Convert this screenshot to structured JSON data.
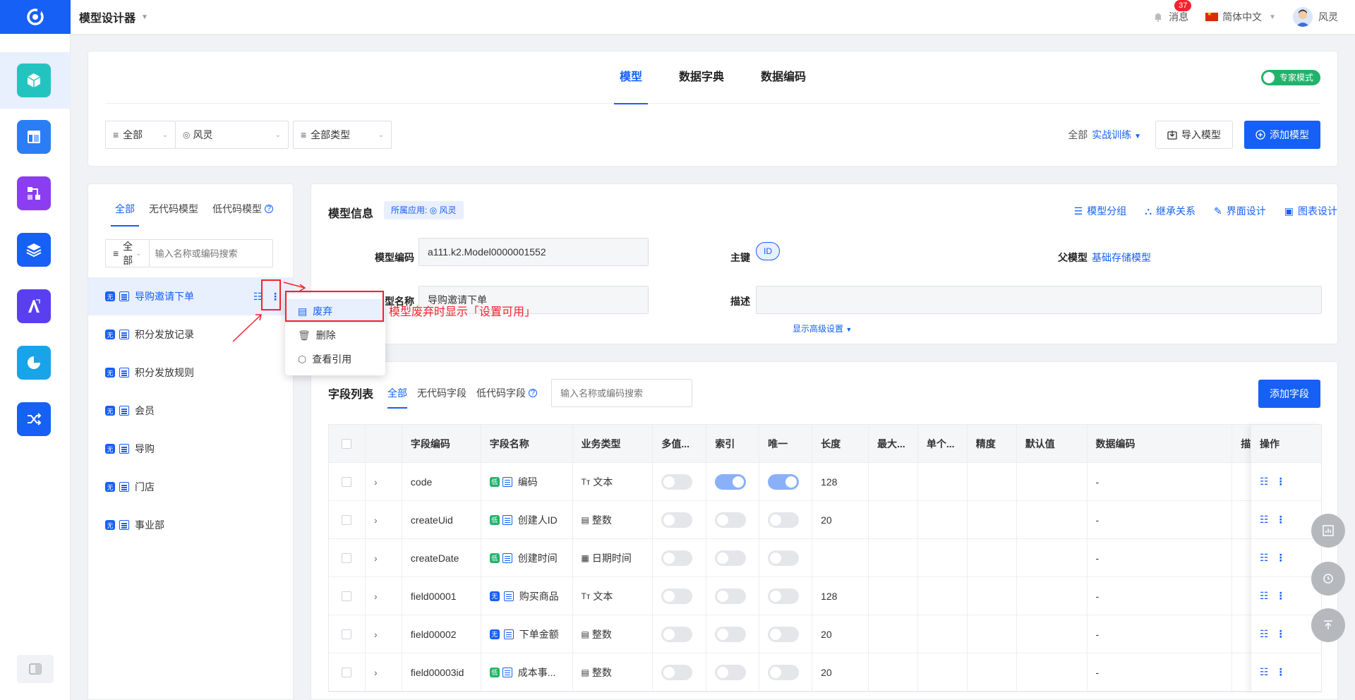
{
  "app": {
    "title": "模型设计器"
  },
  "topbar": {
    "messages": "消息",
    "badge": "37",
    "language": "简体中文",
    "user": "风灵"
  },
  "tabs": [
    {
      "label": "模型"
    },
    {
      "label": "数据字典"
    },
    {
      "label": "数据编码"
    }
  ],
  "expert_mode": "专家模式",
  "filters": {
    "scope": "全部",
    "owner": "风灵",
    "type": "全部类型"
  },
  "filter_right": {
    "all": "全部",
    "training": "实战训练",
    "import": "导入模型",
    "add": "添加模型"
  },
  "left": {
    "tabs": [
      {
        "label": "全部"
      },
      {
        "label": "无代码模型"
      },
      {
        "label": "低代码模型"
      }
    ],
    "scope": "全部",
    "search_placeholder": "输入名称或编码搜索",
    "items": [
      {
        "label": "导购邀请下单",
        "tag": "无"
      },
      {
        "label": "积分发放记录",
        "tag": "无"
      },
      {
        "label": "积分发放规则",
        "tag": "无"
      },
      {
        "label": "会员",
        "tag": "无"
      },
      {
        "label": "导购",
        "tag": "无"
      },
      {
        "label": "门店",
        "tag": "无"
      },
      {
        "label": "事业部",
        "tag": "无"
      }
    ]
  },
  "popup": {
    "items": [
      {
        "label": "废弃"
      },
      {
        "label": "删除"
      },
      {
        "label": "查看引用"
      }
    ]
  },
  "annotation": "模型废弃时显示「设置可用」",
  "info": {
    "title": "模型信息",
    "app_prefix": "所属应用:",
    "app_name": "风灵",
    "actions": [
      {
        "label": "模型分组"
      },
      {
        "label": "继承关系"
      },
      {
        "label": "界面设计"
      },
      {
        "label": "图表设计"
      }
    ],
    "code_label": "模型编码",
    "code_value": "a111.k2.Model0000001552",
    "pk_label": "主键",
    "pk_value": "ID",
    "parent_label": "父模型",
    "parent_value": "基础存储模型",
    "name_label": "型名称",
    "name_value": "导购邀请下单",
    "desc_label": "描述",
    "advanced": "显示高级设置"
  },
  "fields": {
    "title": "字段列表",
    "tabs": [
      {
        "label": "全部"
      },
      {
        "label": "无代码字段"
      },
      {
        "label": "低代码字段"
      }
    ],
    "search_placeholder": "输入名称或编码搜索",
    "add_button": "添加字段",
    "columns": [
      "字段编码",
      "字段名称",
      "业务类型",
      "多值...",
      "索引",
      "唯一",
      "长度",
      "最大...",
      "单个...",
      "精度",
      "默认值",
      "数据编码",
      "描述",
      "操作"
    ],
    "rows": [
      {
        "code": "code",
        "tag": "低",
        "name": "编码",
        "type": "文本",
        "type_icon": "Tт",
        "multi": false,
        "index": true,
        "unique": true,
        "length": "128",
        "encoding": "-"
      },
      {
        "code": "createUid",
        "tag": "低",
        "name": "创建人ID",
        "type": "整数",
        "type_icon": "▤",
        "multi": false,
        "index": false,
        "unique": false,
        "length": "20",
        "encoding": "-"
      },
      {
        "code": "createDate",
        "tag": "低",
        "name": "创建时间",
        "type": "日期时间",
        "type_icon": "▦",
        "multi": false,
        "index": false,
        "unique": false,
        "length": "",
        "encoding": "-"
      },
      {
        "code": "field00001",
        "tag": "无",
        "name": "购买商品",
        "type": "文本",
        "type_icon": "Tт",
        "multi": false,
        "index": false,
        "unique": false,
        "length": "128",
        "encoding": "-"
      },
      {
        "code": "field00002",
        "tag": "无",
        "name": "下单金额",
        "type": "整数",
        "type_icon": "▤",
        "multi": false,
        "index": false,
        "unique": false,
        "length": "20",
        "encoding": "-"
      },
      {
        "code": "field00003id",
        "tag": "低",
        "name": "成本事...",
        "type": "整数",
        "type_icon": "▤",
        "multi": false,
        "index": false,
        "unique": false,
        "length": "20",
        "encoding": "-"
      }
    ]
  }
}
